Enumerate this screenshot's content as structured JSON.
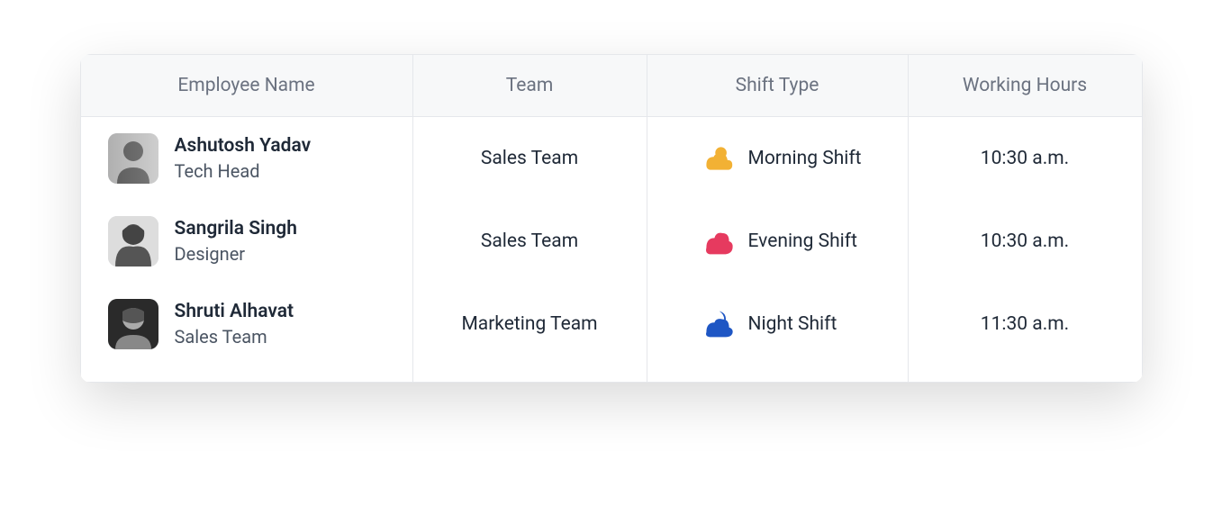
{
  "table": {
    "headers": {
      "name": "Employee Name",
      "team": "Team",
      "shift": "Shift Type",
      "hours": "Working Hours"
    },
    "rows": [
      {
        "name": "Ashutosh Yadav",
        "role": "Tech Head",
        "team": "Sales Team",
        "shift": "Morning Shift",
        "shift_icon": "sun-cloud-icon",
        "shift_color": "#f2b134",
        "hours": "10:30 a.m."
      },
      {
        "name": "Sangrila Singh",
        "role": "Designer",
        "team": "Sales Team",
        "shift": "Evening Shift",
        "shift_icon": "cloud-icon",
        "shift_color": "#e63a5f",
        "hours": "10:30 a.m."
      },
      {
        "name": "Shruti Alhavat",
        "role": "Sales Team",
        "team": "Marketing Team",
        "shift": "Night Shift",
        "shift_icon": "moon-cloud-icon",
        "shift_color": "#1e56c4",
        "hours": "11:30 a.m."
      }
    ]
  }
}
